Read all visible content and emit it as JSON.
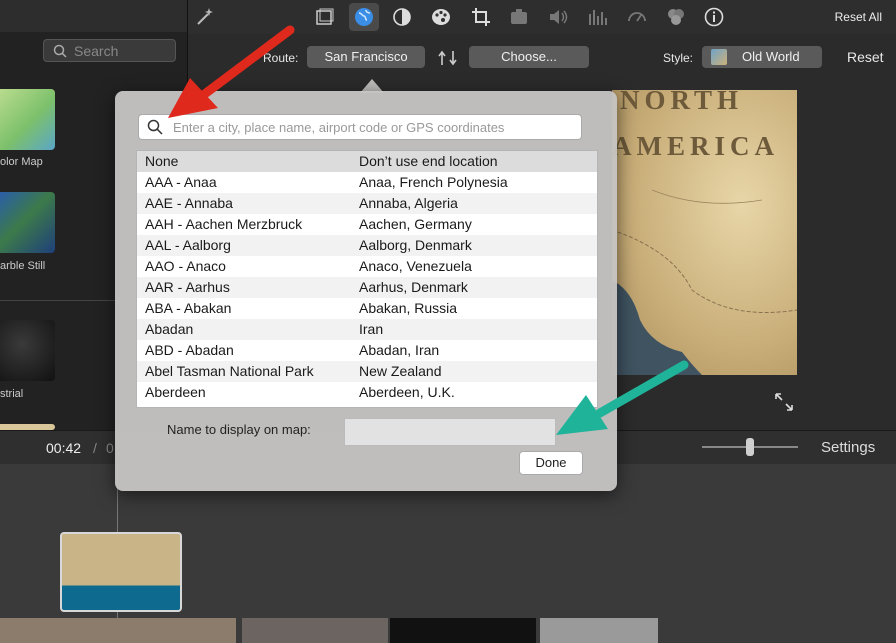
{
  "left_panel": {
    "search_placeholder": "Search",
    "thumbnails": [
      {
        "label": "olor Map"
      },
      {
        "label": "arble Still"
      },
      {
        "label": "strial"
      }
    ]
  },
  "toolbar": {
    "reset_all_label": "Reset All",
    "icons": [
      "magic-wand-icon",
      "crop-frame-icon",
      "globe-icon",
      "color-balance-icon",
      "palette-icon",
      "crop-icon",
      "camera-icon",
      "volume-icon",
      "equalizer-icon",
      "speed-icon",
      "overlay-icon",
      "info-icon"
    ]
  },
  "route_bar": {
    "route_label": "Route:",
    "route_value": "San Francisco",
    "choose_label": "Choose...",
    "style_label": "Style:",
    "style_value": "Old World",
    "reset_label": "Reset"
  },
  "map": {
    "text_line1": "NORTH",
    "text_line2": "AMERICA"
  },
  "popover": {
    "search_placeholder": "Enter a city, place name, airport code or GPS coordinates",
    "rows": [
      {
        "name": "None",
        "location": "Don’t use end location"
      },
      {
        "name": "AAA - Anaa",
        "location": "Anaa, French Polynesia"
      },
      {
        "name": "AAE - Annaba",
        "location": "Annaba, Algeria"
      },
      {
        "name": "AAH - Aachen Merzbruck",
        "location": "Aachen, Germany"
      },
      {
        "name": "AAL - Aalborg",
        "location": "Aalborg, Denmark"
      },
      {
        "name": "AAO - Anaco",
        "location": "Anaco, Venezuela"
      },
      {
        "name": "AAR - Aarhus",
        "location": "Aarhus, Denmark"
      },
      {
        "name": "ABA - Abakan",
        "location": "Abakan, Russia"
      },
      {
        "name": "Abadan",
        "location": "Iran"
      },
      {
        "name": "ABD - Abadan",
        "location": "Abadan, Iran"
      },
      {
        "name": "Abel Tasman National Park",
        "location": "New Zealand"
      },
      {
        "name": "Aberdeen",
        "location": "Aberdeen, U.K."
      }
    ],
    "name_display_label": "Name to display on map:",
    "name_display_value": "",
    "done_label": "Done"
  },
  "timebar": {
    "timecode": "00:42",
    "separator": "/",
    "total_fragment": "0",
    "settings_label": "Settings"
  },
  "colors": {
    "red_arrow": "#e0291d",
    "teal_arrow": "#1fb39a",
    "globe_accent": "#3a8ee6"
  }
}
